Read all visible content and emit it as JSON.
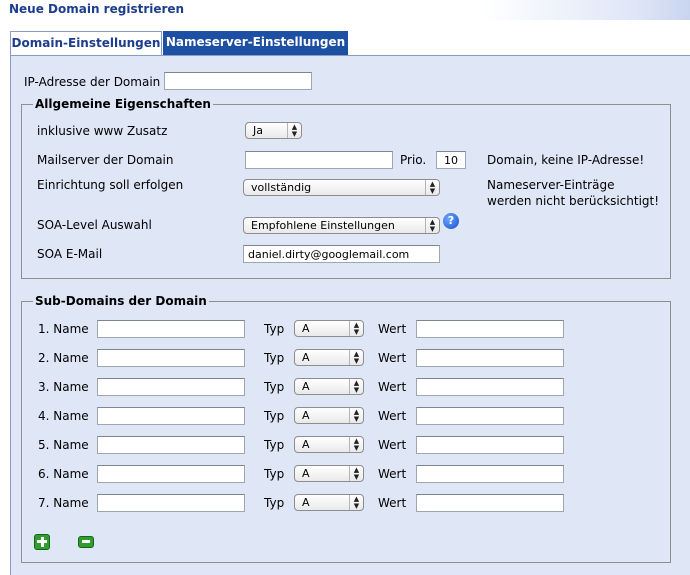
{
  "window": {
    "title": "Neue Domain registrieren"
  },
  "tabs": [
    {
      "label": "Domain-Einstellungen",
      "active": false
    },
    {
      "label": "Nameserver-Einstellungen",
      "active": true
    }
  ],
  "ip": {
    "label": "IP-Adresse der Domain",
    "value": ""
  },
  "general": {
    "legend": "Allgemeine Eigenschaften",
    "www_label": "inklusive www Zusatz",
    "www_value": "Ja",
    "mail_label": "Mailserver der Domain",
    "mail_value": "",
    "prio_label": "Prio.",
    "prio_value": "10",
    "mail_note": "Domain, keine IP-Adresse!",
    "setup_label": "Einrichtung soll erfolgen",
    "setup_value": "vollständig",
    "setup_note_1": "Nameserver-Einträge",
    "setup_note_2": "werden nicht berücksichtigt!",
    "soa_level_label": "SOA-Level Auswahl",
    "soa_level_value": "Empfohlene Einstellungen",
    "help_icon": "?",
    "soa_email_label": "SOA E-Mail",
    "soa_email_value": "daniel.dirty@googlemail.com"
  },
  "subdomains": {
    "legend": "Sub-Domains der Domain",
    "type_label": "Typ",
    "value_label": "Wert",
    "rows": [
      {
        "label": "1. Name",
        "name": "",
        "type": "A",
        "value": ""
      },
      {
        "label": "2. Name",
        "name": "",
        "type": "A",
        "value": ""
      },
      {
        "label": "3. Name",
        "name": "",
        "type": "A",
        "value": ""
      },
      {
        "label": "4. Name",
        "name": "",
        "type": "A",
        "value": ""
      },
      {
        "label": "5. Name",
        "name": "",
        "type": "A",
        "value": ""
      },
      {
        "label": "6. Name",
        "name": "",
        "type": "A",
        "value": ""
      },
      {
        "label": "7. Name",
        "name": "",
        "type": "A",
        "value": ""
      }
    ],
    "add_icon": "plus-icon",
    "remove_icon": "minus-icon"
  },
  "colors": {
    "title": "#1d3d8e",
    "tab_active_bg": "#1d4fa3",
    "panel_bg": "#dfe6f6"
  }
}
